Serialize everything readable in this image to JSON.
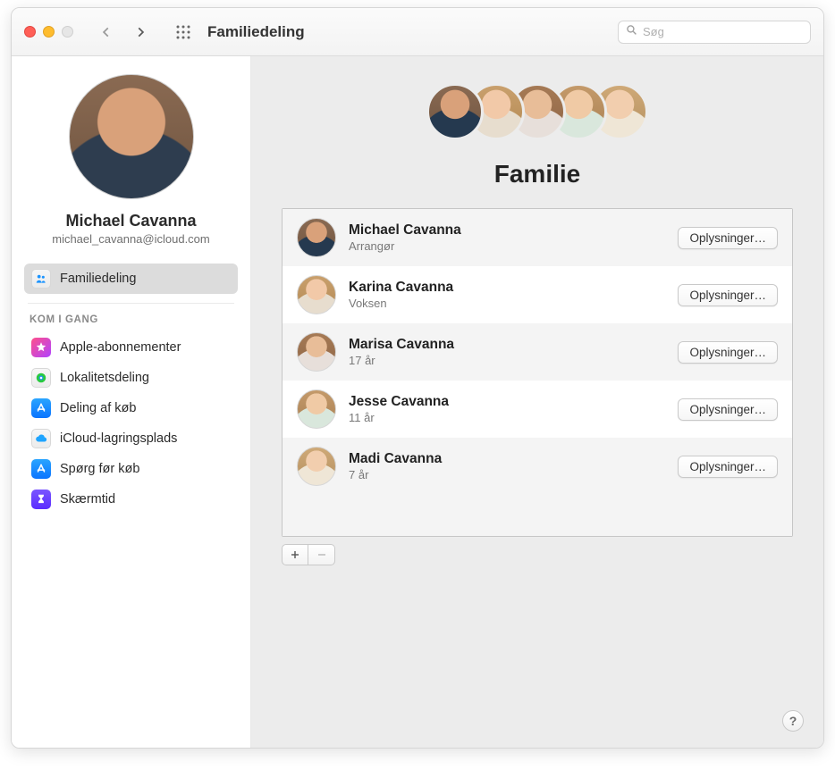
{
  "window": {
    "title": "Familiedeling"
  },
  "search": {
    "placeholder": "Søg"
  },
  "profile": {
    "name": "Michael Cavanna",
    "email": "michael_cavanna@icloud.com"
  },
  "sidebar": {
    "primary": {
      "label": "Familiedeling"
    },
    "section_header": "KOM I GANG",
    "items": [
      {
        "label": "Apple-abonnementer"
      },
      {
        "label": "Lokalitetsdeling"
      },
      {
        "label": "Deling af køb"
      },
      {
        "label": "iCloud-lagringsplads"
      },
      {
        "label": "Spørg før køb"
      },
      {
        "label": "Skærmtid"
      }
    ]
  },
  "main": {
    "title": "Familie",
    "details_btn": "Oplysninger…",
    "members": [
      {
        "name": "Michael Cavanna",
        "role": "Arrangør"
      },
      {
        "name": "Karina Cavanna",
        "role": "Voksen"
      },
      {
        "name": "Marisa Cavanna",
        "role": "17 år"
      },
      {
        "name": "Jesse Cavanna",
        "role": "11 år"
      },
      {
        "name": "Madi Cavanna",
        "role": "7 år"
      }
    ]
  },
  "help_glyph": "?"
}
